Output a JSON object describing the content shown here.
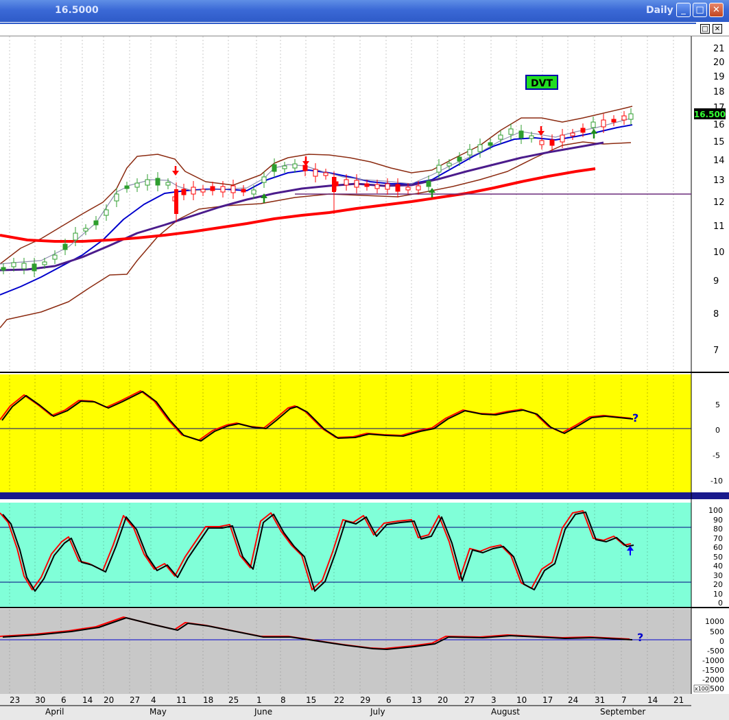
{
  "window": {
    "price": "16.5000",
    "period": "Daily",
    "min": "_",
    "max": "□",
    "close": "✕",
    "restore": "□",
    "close2": "✕"
  },
  "ticker": "DVT",
  "last_price_badge": "16.500",
  "price_axis": [
    "21",
    "20",
    "19",
    "18",
    "17",
    "16",
    "15",
    "14",
    "13",
    "12",
    "11",
    "10",
    "9",
    "8",
    "7"
  ],
  "osc1_axis": [
    "5",
    "0",
    "-5",
    "-10"
  ],
  "osc2_axis": [
    "100",
    "90",
    "80",
    "70",
    "60",
    "50",
    "40",
    "30",
    "20",
    "10",
    "0"
  ],
  "osc3_axis": [
    "1000",
    "500",
    "0",
    "-500",
    "-1000",
    "-1500",
    "-2000",
    "-2500"
  ],
  "osc3_multiplier": "x100",
  "question_mark": "?",
  "x_days": [
    "23",
    "30",
    "6",
    "14",
    "20",
    "27",
    "4",
    "11",
    "18",
    "25",
    "1",
    "8",
    "15",
    "22",
    "29",
    "6",
    "13",
    "20",
    "27",
    "3",
    "10",
    "17",
    "24",
    "31",
    "7",
    "14",
    "21"
  ],
  "x_months": [
    "April",
    "May",
    "June",
    "July",
    "August",
    "September"
  ],
  "colors": {
    "price_bg": "#ffffff",
    "osc1_bg": "#ffff00",
    "osc2_bg": "#80ffd8",
    "osc3_bg": "#c8c8c8",
    "red": "#ff0000",
    "blue": "#0000cc",
    "purple": "#4b1c8c",
    "brown": "#8b2a10",
    "green": "#2e9e2e"
  },
  "chart_data": [
    {
      "type": "candlestick",
      "title": "DVT",
      "period": "Daily",
      "y_scale": "log",
      "ylim": [
        6.5,
        22
      ],
      "last": 16.5,
      "series": [
        {
          "name": "close",
          "values": [
            9.3,
            9.4,
            9.6,
            10.0,
            10.5,
            11.2,
            12.5,
            13.0,
            12.9,
            12.5,
            12.4,
            12.5,
            13.5,
            13.4,
            13.0,
            12.8,
            12.6,
            12.5,
            12.6,
            13.4,
            14.0,
            15.0,
            15.6,
            15.4,
            15.1,
            15.5,
            16.0,
            16.3,
            16.5
          ]
        }
      ]
    },
    {
      "type": "line",
      "axis": [
        5,
        0,
        -5,
        -10
      ],
      "ylim": [
        -12,
        9
      ]
    },
    {
      "type": "line",
      "axis": [
        0,
        100
      ],
      "ylim": [
        -5,
        105
      ],
      "levels": [
        80,
        20
      ]
    },
    {
      "type": "line",
      "axis": [
        1000,
        -2500
      ],
      "ylim": [
        -2700,
        1300
      ],
      "levels": [
        0
      ]
    }
  ]
}
